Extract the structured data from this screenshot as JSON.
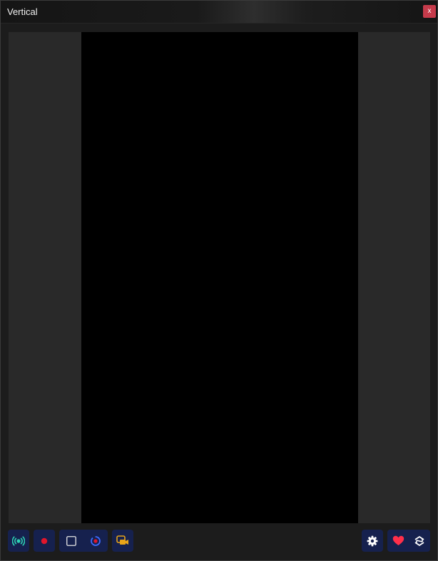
{
  "window": {
    "title": "Vertical",
    "close_label": "x"
  },
  "colors": {
    "accent_button_bg": "#16214e",
    "close_button_bg": "#c63b4b",
    "broadcast_icon": "#2ed1b4",
    "record_icon": "#e0162b",
    "replay_buffer_icon": "#3d6bff",
    "virtual_cam_icon": "#e8a418",
    "heart_icon": "#ff2f4a"
  },
  "toolbar": {
    "left_icons": [
      "broadcast-icon",
      "record-icon",
      "stop-square-icon",
      "replay-buffer-icon",
      "virtual-camera-icon"
    ],
    "right_icons": [
      "gear-icon",
      "heart-icon",
      "hash-swap-icon"
    ]
  }
}
